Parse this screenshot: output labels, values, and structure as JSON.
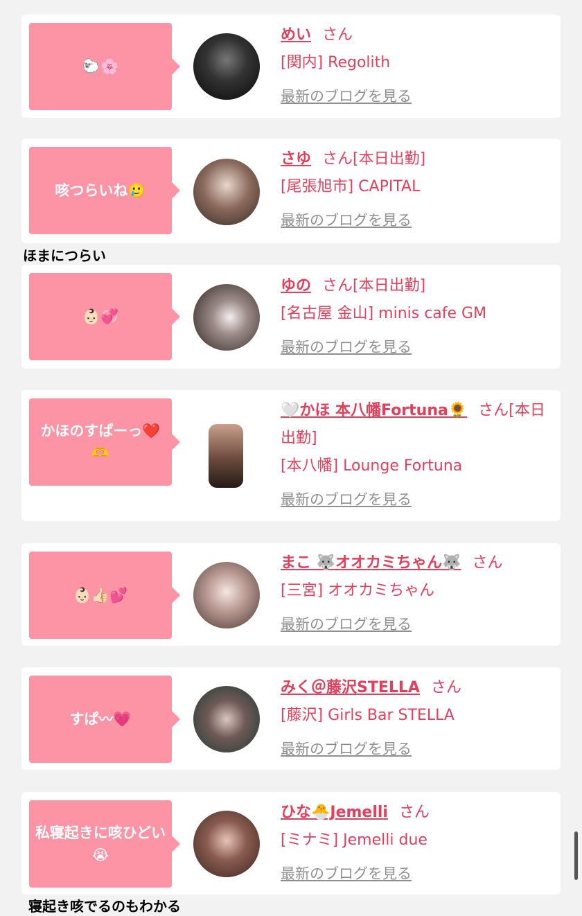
{
  "cards": [
    {
      "bubble": "🐑🌸",
      "name": "めい",
      "san": "さん",
      "shop": "[関内] Regolith",
      "blog": "最新のブログを見る"
    },
    {
      "bubble": "咳つらいね🥲",
      "name": "さゆ",
      "san": "さん[本日出勤]",
      "shop": "[尾張旭市] CAPITAL",
      "blog": "最新のブログを見る"
    },
    {
      "bubble": "👶🏻💞",
      "name": "ゆの",
      "san": "さん[本日出勤]",
      "shop": "[名古屋 金山] minis cafe GM",
      "blog": "最新のブログを見る"
    },
    {
      "bubble": "かほのすぱーっ❤️🫶",
      "name": "🤍かほ 本八幡Fortuna🌻",
      "san": "さん[本日出勤]",
      "shop": "[本八幡] Lounge Fortuna",
      "blog": "最新のブログを見る"
    },
    {
      "bubble": "👶🏻👍🏻💕",
      "name": "まこ 🐺オオカミちゃん🐺",
      "san": "さん",
      "shop": "[三宮] オオカミちゃん",
      "blog": "最新のブログを見る"
    },
    {
      "bubble": "すぱ〰💗",
      "name": "みく＠藤沢STELLA",
      "san": "さん",
      "shop": "[藤沢] Girls Bar STELLA",
      "blog": "最新のブログを見る"
    },
    {
      "bubble": "私寝起きに咳ひどい😭",
      "name": "ひな🐣Jemelli",
      "san": "さん",
      "shop": "[ミナミ] Jemelli due",
      "blog": "最新のブログを見る"
    }
  ],
  "captions": {
    "first": "ほまにつらい",
    "second": "寝起き咳でるのもわかる"
  },
  "colors": {
    "bubble": "#fd94a6",
    "accent": "#e0405c",
    "link_gray": "#8f8f8f",
    "background": "#f2f2f2"
  }
}
